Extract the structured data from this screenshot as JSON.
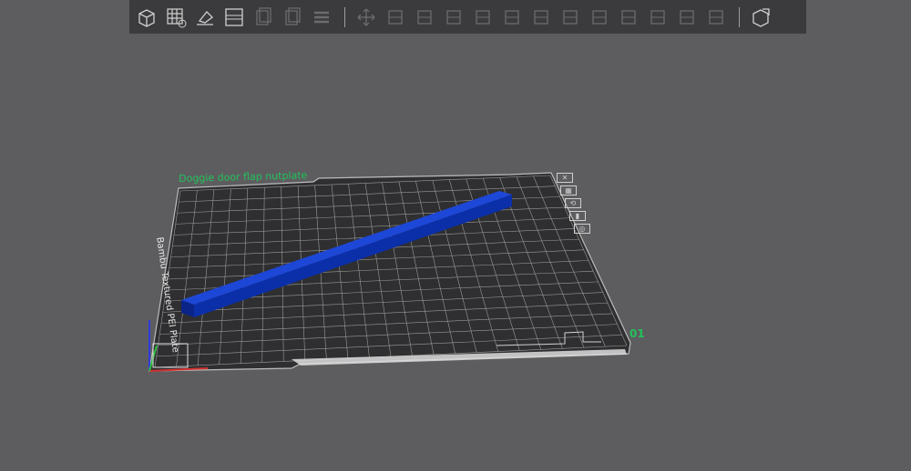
{
  "toolbar": {
    "groups": [
      [
        {
          "name": "add-object-icon",
          "label": "Add"
        },
        {
          "name": "add-plate-icon",
          "label": "Add plate"
        },
        {
          "name": "auto-orient-icon",
          "label": "Auto orient"
        },
        {
          "name": "arrange-icon",
          "label": "Arrange"
        },
        {
          "name": "copy-icon",
          "label": "Copy"
        },
        {
          "name": "paste-icon",
          "label": "Paste"
        },
        {
          "name": "layers-icon",
          "label": "Layers"
        }
      ],
      [
        {
          "name": "move-icon",
          "label": "Move"
        },
        {
          "name": "rotate-icon",
          "label": "Rotate"
        },
        {
          "name": "scale-icon",
          "label": "Scale"
        },
        {
          "name": "lay-on-face-icon",
          "label": "Lay on face"
        },
        {
          "name": "cut-icon",
          "label": "Cut"
        },
        {
          "name": "mesh-boolean-icon",
          "label": "Mesh boolean"
        },
        {
          "name": "support-paint-icon",
          "label": "Support painting"
        },
        {
          "name": "seam-paint-icon",
          "label": "Seam painting"
        },
        {
          "name": "text-icon",
          "label": "Text"
        },
        {
          "name": "measure-icon",
          "label": "Measure"
        },
        {
          "name": "split-icon",
          "label": "Split"
        },
        {
          "name": "variable-layer-icon",
          "label": "Variable layer height"
        },
        {
          "name": "assembly-icon",
          "label": "Assembly"
        }
      ],
      [
        {
          "name": "view-export-icon",
          "label": "Export"
        }
      ]
    ]
  },
  "plate": {
    "name": "Doggie door flap nutplate",
    "index": "01",
    "bed_label": "Bambu Textured PEI Plate",
    "color_plate_lines": "#c8c8c8",
    "color_plate_bg": "#2f2f31",
    "color_name": "#22c25a"
  },
  "model": {
    "color": "#0b2fa8"
  },
  "plate_icons": [
    "close",
    "arrange",
    "orient",
    "lock",
    "settings"
  ]
}
